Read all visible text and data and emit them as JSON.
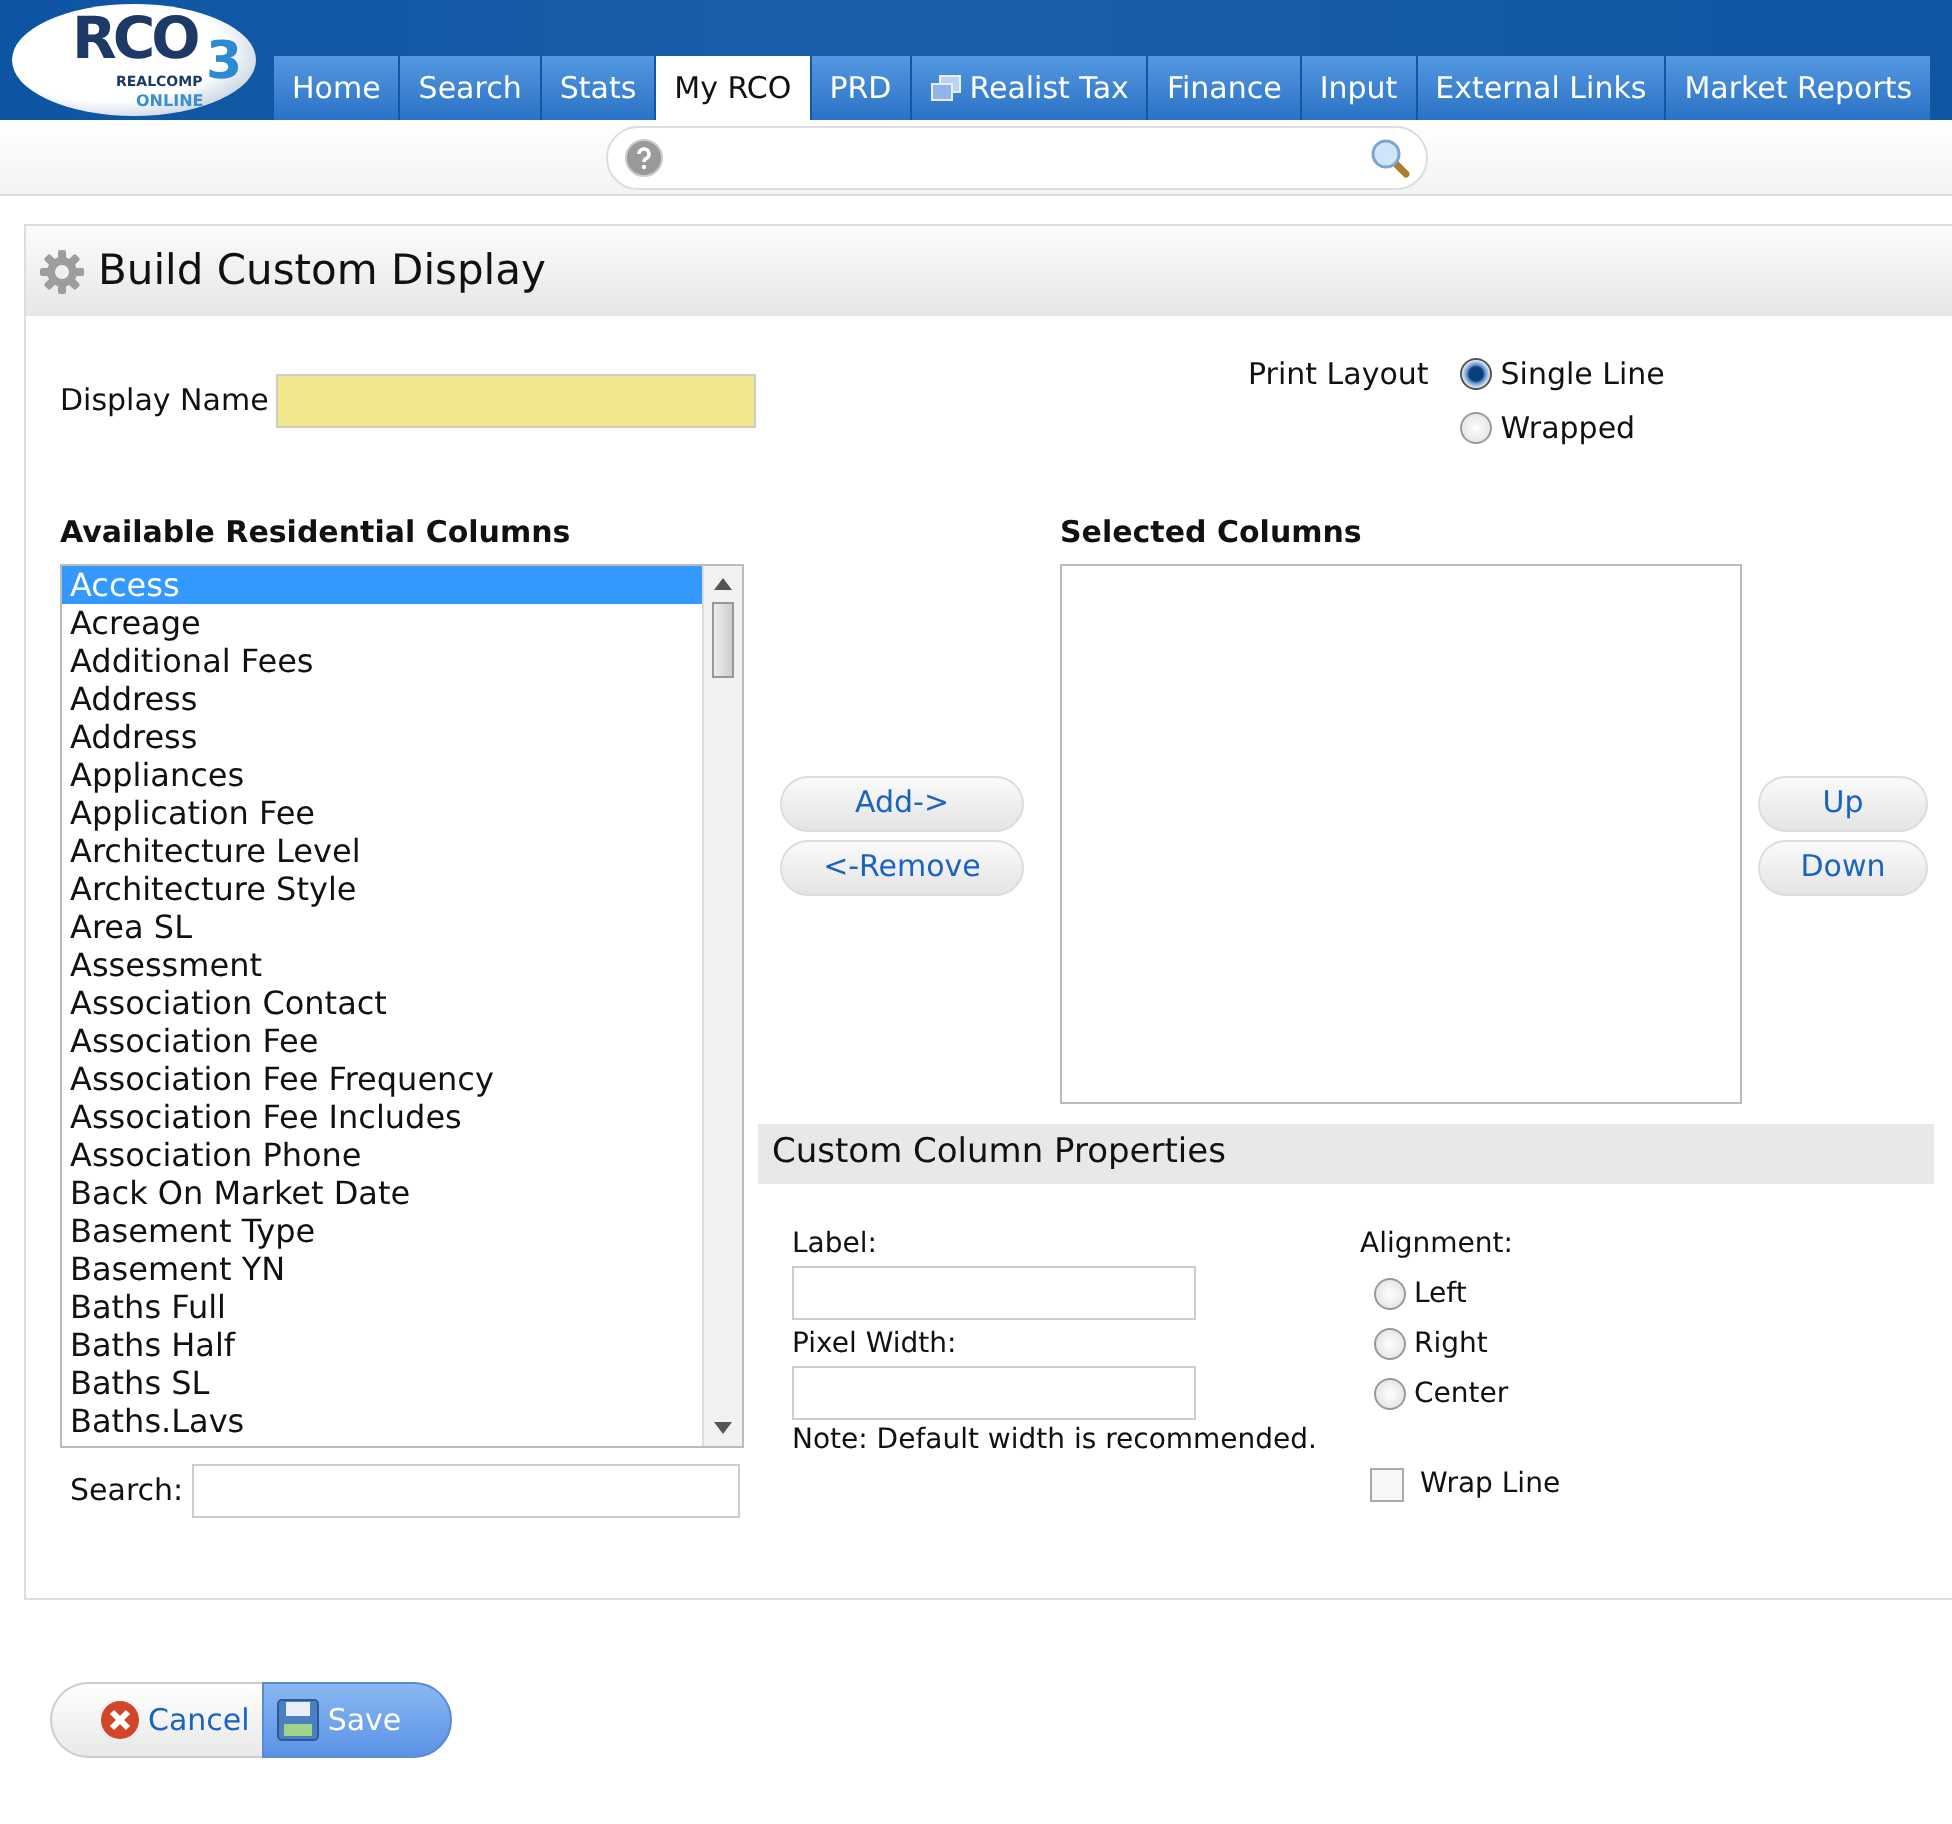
{
  "logo": {
    "name": "RCO",
    "edition": "3",
    "line_1": "REALCOMP",
    "line_2": "ONLINE"
  },
  "tabs": [
    {
      "label": "Home",
      "selected": false,
      "has_icon": false
    },
    {
      "label": "Search",
      "selected": false,
      "has_icon": false
    },
    {
      "label": "Stats",
      "selected": false,
      "has_icon": false
    },
    {
      "label": "My RCO",
      "selected": true,
      "has_icon": false
    },
    {
      "label": "PRD",
      "selected": false,
      "has_icon": false
    },
    {
      "label": "Realist Tax",
      "selected": false,
      "has_icon": true
    },
    {
      "label": "Finance",
      "selected": false,
      "has_icon": false
    },
    {
      "label": "Input",
      "selected": false,
      "has_icon": false
    },
    {
      "label": "External Links",
      "selected": false,
      "has_icon": false
    },
    {
      "label": "Market Reports",
      "selected": false,
      "has_icon": false
    }
  ],
  "panel": {
    "title": "Build Custom Display"
  },
  "display_name": {
    "label": "Display Name"
  },
  "print_layout": {
    "label": "Print Layout",
    "options": [
      {
        "label": "Single Line",
        "selected": true
      },
      {
        "label": "Wrapped",
        "selected": false
      }
    ]
  },
  "available": {
    "heading": "Available Residential Columns",
    "items": [
      {
        "label": "Access",
        "selected": true
      },
      {
        "label": "Acreage",
        "selected": false
      },
      {
        "label": "Additional Fees",
        "selected": false
      },
      {
        "label": "Address",
        "selected": false
      },
      {
        "label": "Address",
        "selected": false
      },
      {
        "label": "Appliances",
        "selected": false
      },
      {
        "label": "Application Fee",
        "selected": false
      },
      {
        "label": "Architecture Level",
        "selected": false
      },
      {
        "label": "Architecture Style",
        "selected": false
      },
      {
        "label": "Area SL",
        "selected": false
      },
      {
        "label": "Assessment",
        "selected": false
      },
      {
        "label": "Association Contact",
        "selected": false
      },
      {
        "label": "Association Fee",
        "selected": false
      },
      {
        "label": "Association Fee Frequency",
        "selected": false
      },
      {
        "label": "Association Fee Includes",
        "selected": false
      },
      {
        "label": "Association Phone",
        "selected": false
      },
      {
        "label": "Back On Market Date",
        "selected": false
      },
      {
        "label": "Basement Type",
        "selected": false
      },
      {
        "label": "Basement YN",
        "selected": false
      },
      {
        "label": "Baths Full",
        "selected": false
      },
      {
        "label": "Baths Half",
        "selected": false
      },
      {
        "label": "Baths SL",
        "selected": false
      },
      {
        "label": "Baths.Lavs",
        "selected": false
      }
    ],
    "search_label": "Search:"
  },
  "move_buttons": [
    "Add->",
    "<-Remove"
  ],
  "selected_columns": {
    "heading": "Selected Columns"
  },
  "order_buttons": [
    "Up",
    "Down"
  ],
  "properties": {
    "title": "Custom Column Properties",
    "label_label": "Label:",
    "width_label": "Pixel Width:",
    "note": "Note: Default width is recommended.",
    "alignment": {
      "label": "Alignment:",
      "options": [
        {
          "label": "Left",
          "selected": false
        },
        {
          "label": "Right",
          "selected": false
        },
        {
          "label": "Center",
          "selected": false
        }
      ]
    },
    "wrap_line": {
      "label": "Wrap Line",
      "checked": false
    }
  },
  "footer": {
    "cancel": "Cancel",
    "save": "Save"
  }
}
